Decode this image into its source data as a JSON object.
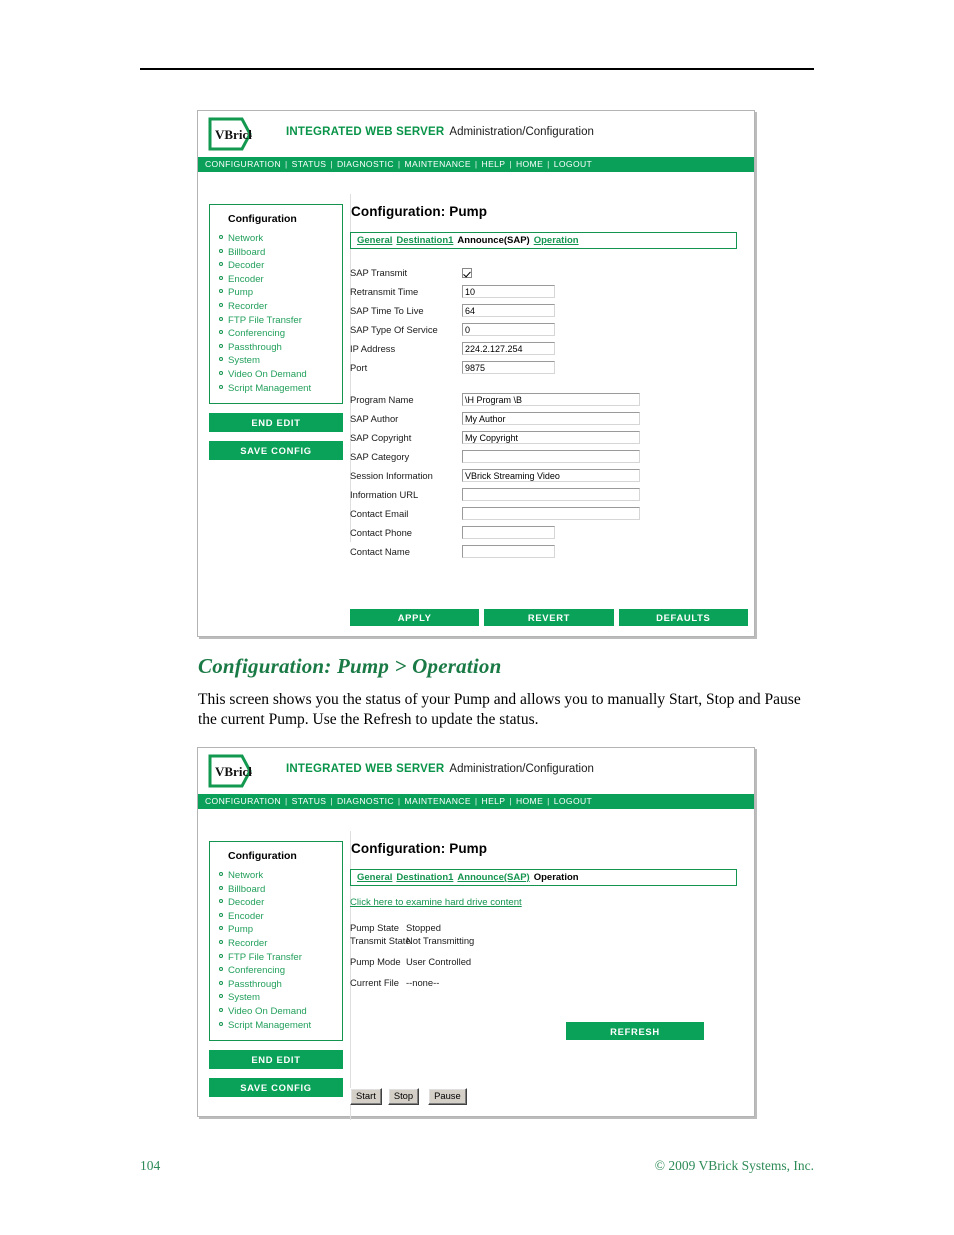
{
  "page": {
    "number": "104",
    "copyright": "© 2009 VBrick Systems, Inc."
  },
  "section": {
    "heading": "Configuration: Pump > Operation",
    "paragraph": "This screen shows you the status of your Pump and allows you to manually Start, Stop and Pause the current Pump. Use the Refresh to update the status."
  },
  "colors": {
    "brand_green": "#0aa158",
    "link_green": "#14944f",
    "heading_green": "#1a7a45",
    "sidebar_text": "#23a05c"
  },
  "webserver": {
    "logo_text": "VBrick",
    "title_bold": "INTEGRATED WEB SERVER",
    "title_sub": "Administration/Configuration",
    "nav": [
      "CONFIGURATION",
      "STATUS",
      "DIAGNOSTIC",
      "MAINTENANCE",
      "HELP",
      "HOME",
      "LOGOUT"
    ],
    "sidebar": {
      "title": "Configuration",
      "items": [
        "Network",
        "Billboard",
        "Decoder",
        "Encoder",
        "Pump",
        "Recorder",
        "FTP File Transfer",
        "Conferencing",
        "Passthrough",
        "System",
        "Video On Demand",
        "Script Management"
      ],
      "end_edit_label": "END EDIT",
      "save_config_label": "SAVE CONFIG"
    }
  },
  "shot_sap": {
    "content_title": "Configuration: Pump",
    "tabs": [
      {
        "label": "General",
        "active": false
      },
      {
        "label": "Destination1",
        "active": false
      },
      {
        "label": "Announce(SAP)",
        "active": true
      },
      {
        "label": "Operation",
        "active": false
      }
    ],
    "fields_group1": [
      {
        "label": "SAP Transmit",
        "type": "checkbox",
        "checked": true,
        "value": ""
      },
      {
        "label": "Retransmit Time",
        "type": "text",
        "width": "short",
        "value": "10"
      },
      {
        "label": "SAP Time To Live",
        "type": "text",
        "width": "short",
        "value": "64"
      },
      {
        "label": "SAP Type Of Service",
        "type": "text",
        "width": "short",
        "value": "0"
      },
      {
        "label": "IP Address",
        "type": "text",
        "width": "short",
        "value": "224.2.127.254"
      },
      {
        "label": "Port",
        "type": "text",
        "width": "short",
        "value": "9875"
      }
    ],
    "fields_group2": [
      {
        "label": "Program Name",
        "type": "text",
        "width": "long",
        "value": "\\H Program \\B"
      },
      {
        "label": "SAP Author",
        "type": "text",
        "width": "long",
        "value": "My Author"
      },
      {
        "label": "SAP Copyright",
        "type": "text",
        "width": "long",
        "value": "My Copyright"
      },
      {
        "label": "SAP Category",
        "type": "text",
        "width": "long",
        "value": ""
      },
      {
        "label": "Session Information",
        "type": "text",
        "width": "long",
        "value": "VBrick Streaming Video"
      },
      {
        "label": "Information URL",
        "type": "text",
        "width": "long",
        "value": ""
      },
      {
        "label": "Contact Email",
        "type": "text",
        "width": "long",
        "value": ""
      },
      {
        "label": "Contact Phone",
        "type": "text",
        "width": "short",
        "value": ""
      },
      {
        "label": "Contact Name",
        "type": "text",
        "width": "short",
        "value": ""
      }
    ],
    "actions": [
      "APPLY",
      "REVERT",
      "DEFAULTS"
    ]
  },
  "shot_operation": {
    "content_title": "Configuration: Pump",
    "tabs": [
      {
        "label": "General",
        "active": false
      },
      {
        "label": "Destination1",
        "active": false
      },
      {
        "label": "Announce(SAP)",
        "active": false
      },
      {
        "label": "Operation",
        "active": true
      }
    ],
    "hard_drive_link": "Click here to examine hard drive content",
    "status": [
      {
        "key": "Pump State",
        "value": "Stopped",
        "spaced": false
      },
      {
        "key": "Transmit State",
        "value": "Not Transmitting",
        "spaced": false
      },
      {
        "key": "Pump Mode",
        "value": "User Controlled",
        "spaced": true
      },
      {
        "key": "Current File",
        "value": "--none--",
        "spaced": true
      }
    ],
    "refresh_label": "REFRESH",
    "controls": [
      "Start",
      "Stop",
      "Pause"
    ]
  }
}
